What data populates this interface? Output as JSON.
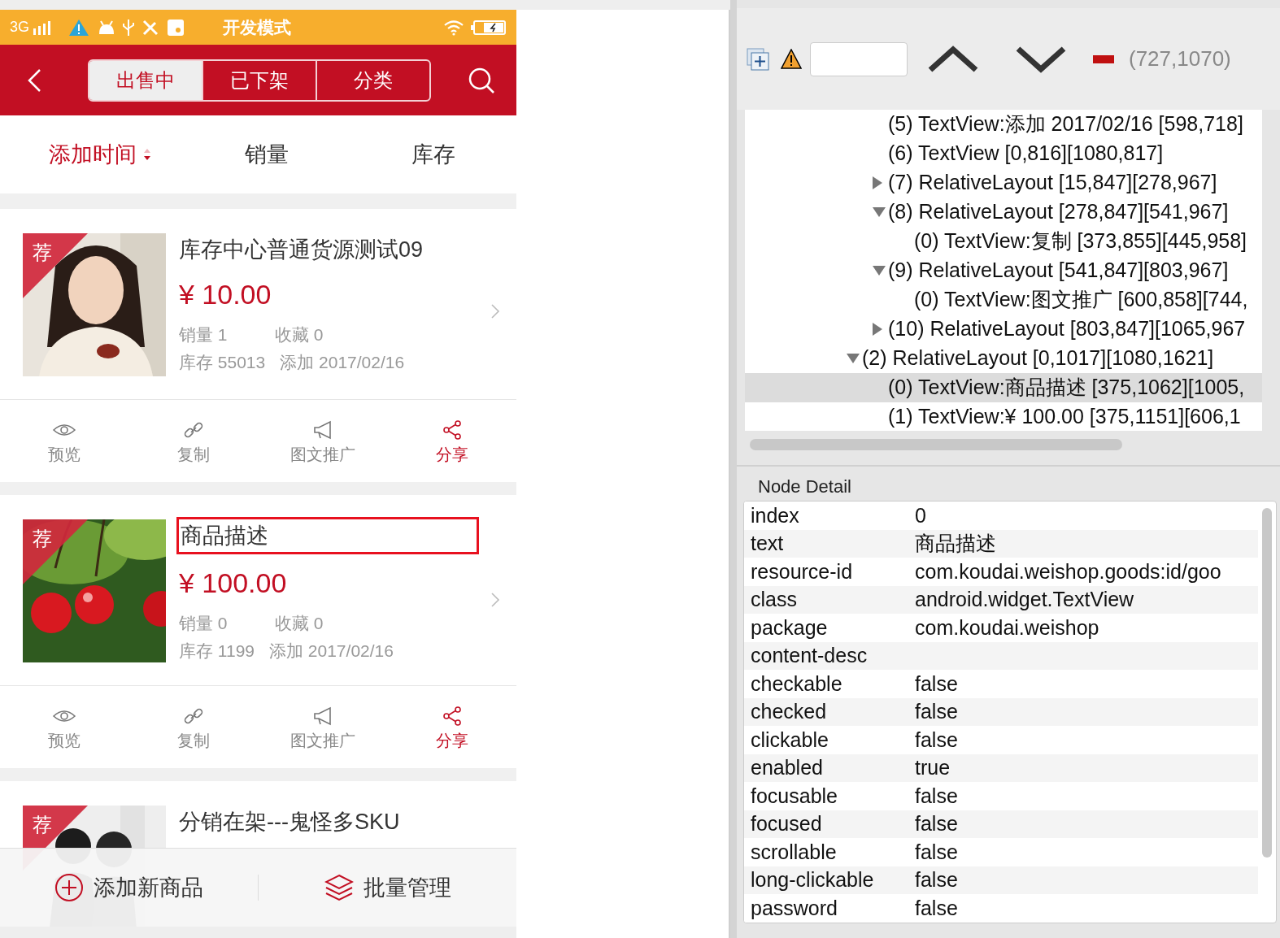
{
  "status_bar": {
    "network": "3G",
    "title": "开发模式"
  },
  "header": {
    "tabs": [
      {
        "label": "出售中",
        "selected": true
      },
      {
        "label": "已下架",
        "selected": false
      },
      {
        "label": "分类",
        "selected": false
      }
    ]
  },
  "sort_bar": [
    {
      "label": "添加时间",
      "selected": true
    },
    {
      "label": "销量",
      "selected": false
    },
    {
      "label": "库存",
      "selected": false
    }
  ],
  "products": [
    {
      "badge": "荐",
      "title": "库存中心普通货源测试09",
      "highlighted": false,
      "price": "¥ 10.00",
      "sales": "销量 1",
      "favorites": "收藏 0",
      "stock": "库存 55013",
      "added": "添加 2017/02/16",
      "actions": [
        {
          "kind": "preview",
          "label": "预览"
        },
        {
          "kind": "copy",
          "label": "复制"
        },
        {
          "kind": "promote",
          "label": "图文推广"
        },
        {
          "kind": "share",
          "label": "分享"
        }
      ]
    },
    {
      "badge": "荐",
      "title": "商品描述",
      "highlighted": true,
      "price": "¥ 100.00",
      "sales": "销量 0",
      "favorites": "收藏 0",
      "stock": "库存 1199",
      "added": "添加 2017/02/16",
      "actions": [
        {
          "kind": "preview",
          "label": "预览"
        },
        {
          "kind": "copy",
          "label": "复制"
        },
        {
          "kind": "promote",
          "label": "图文推广"
        },
        {
          "kind": "share",
          "label": "分享"
        }
      ]
    },
    {
      "badge": "荐",
      "title": "分销在架---鬼怪多SKU",
      "highlighted": false
    }
  ],
  "bottom_bar": [
    {
      "kind": "add",
      "label": "添加新商品"
    },
    {
      "kind": "batch",
      "label": "批量管理"
    }
  ],
  "toolbar": {
    "coordinates": "(727,1070)"
  },
  "tree": {
    "branch": [
      {
        "label": "(5) TextView:添加 2017/02/16 [598,718]",
        "selected": false
      },
      {
        "label": "(6) TextView [0,816][1080,817]",
        "selected": false
      },
      {
        "label": "(7) RelativeLayout [15,847][278,967]",
        "selected": false,
        "expanded": false
      },
      {
        "label": "(8) RelativeLayout [278,847][541,967]",
        "selected": false,
        "expanded": true,
        "children": [
          {
            "label": "(0) TextView:复制 [373,855][445,958]",
            "selected": false
          }
        ]
      },
      {
        "label": "(9) RelativeLayout [541,847][803,967]",
        "selected": false,
        "expanded": true,
        "children": [
          {
            "label": "(0) TextView:图文推广 [600,858][744,",
            "selected": false
          }
        ]
      },
      {
        "label": "(10) RelativeLayout [803,847][1065,967",
        "selected": false,
        "expanded": false
      }
    ],
    "nodes": [
      {
        "label": "(2) RelativeLayout [0,1017][1080,1621]",
        "selected": false,
        "expanded": true,
        "children": [
          {
            "label": "(0) TextView:商品描述 [375,1062][1005,",
            "selected": true
          },
          {
            "label": "(1) TextView:¥ 100.00 [375,1151][606,1",
            "selected": false
          }
        ]
      }
    ]
  },
  "node_detail": {
    "title": "Node Detail",
    "rows": [
      {
        "key": "index",
        "value": "0"
      },
      {
        "key": "text",
        "value": "商品描述"
      },
      {
        "key": "resource-id",
        "value": "com.koudai.weishop.goods:id/goo"
      },
      {
        "key": "class",
        "value": "android.widget.TextView"
      },
      {
        "key": "package",
        "value": "com.koudai.weishop"
      },
      {
        "key": "content-desc"
      },
      {
        "key": "checkable",
        "value": "false"
      },
      {
        "key": "checked",
        "value": "false"
      },
      {
        "key": "clickable",
        "value": "false"
      },
      {
        "key": "enabled",
        "value": "true"
      },
      {
        "key": "focusable",
        "value": "false"
      },
      {
        "key": "focused",
        "value": "false"
      },
      {
        "key": "scrollable",
        "value": "false"
      },
      {
        "key": "long-clickable",
        "value": "false"
      },
      {
        "key": "password",
        "value": "false"
      }
    ]
  }
}
